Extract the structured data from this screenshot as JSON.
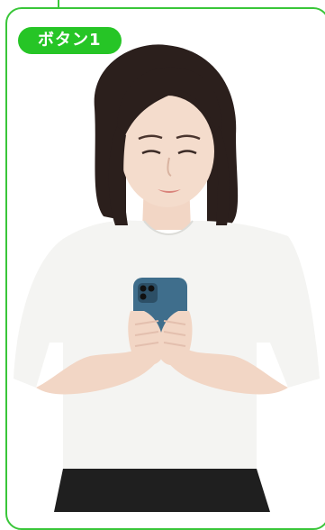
{
  "badge": {
    "label": "ボタン1",
    "color": "#26c526"
  },
  "frame": {
    "border_color": "#39c639"
  },
  "photo": {
    "subject": "woman-using-smartphone"
  }
}
